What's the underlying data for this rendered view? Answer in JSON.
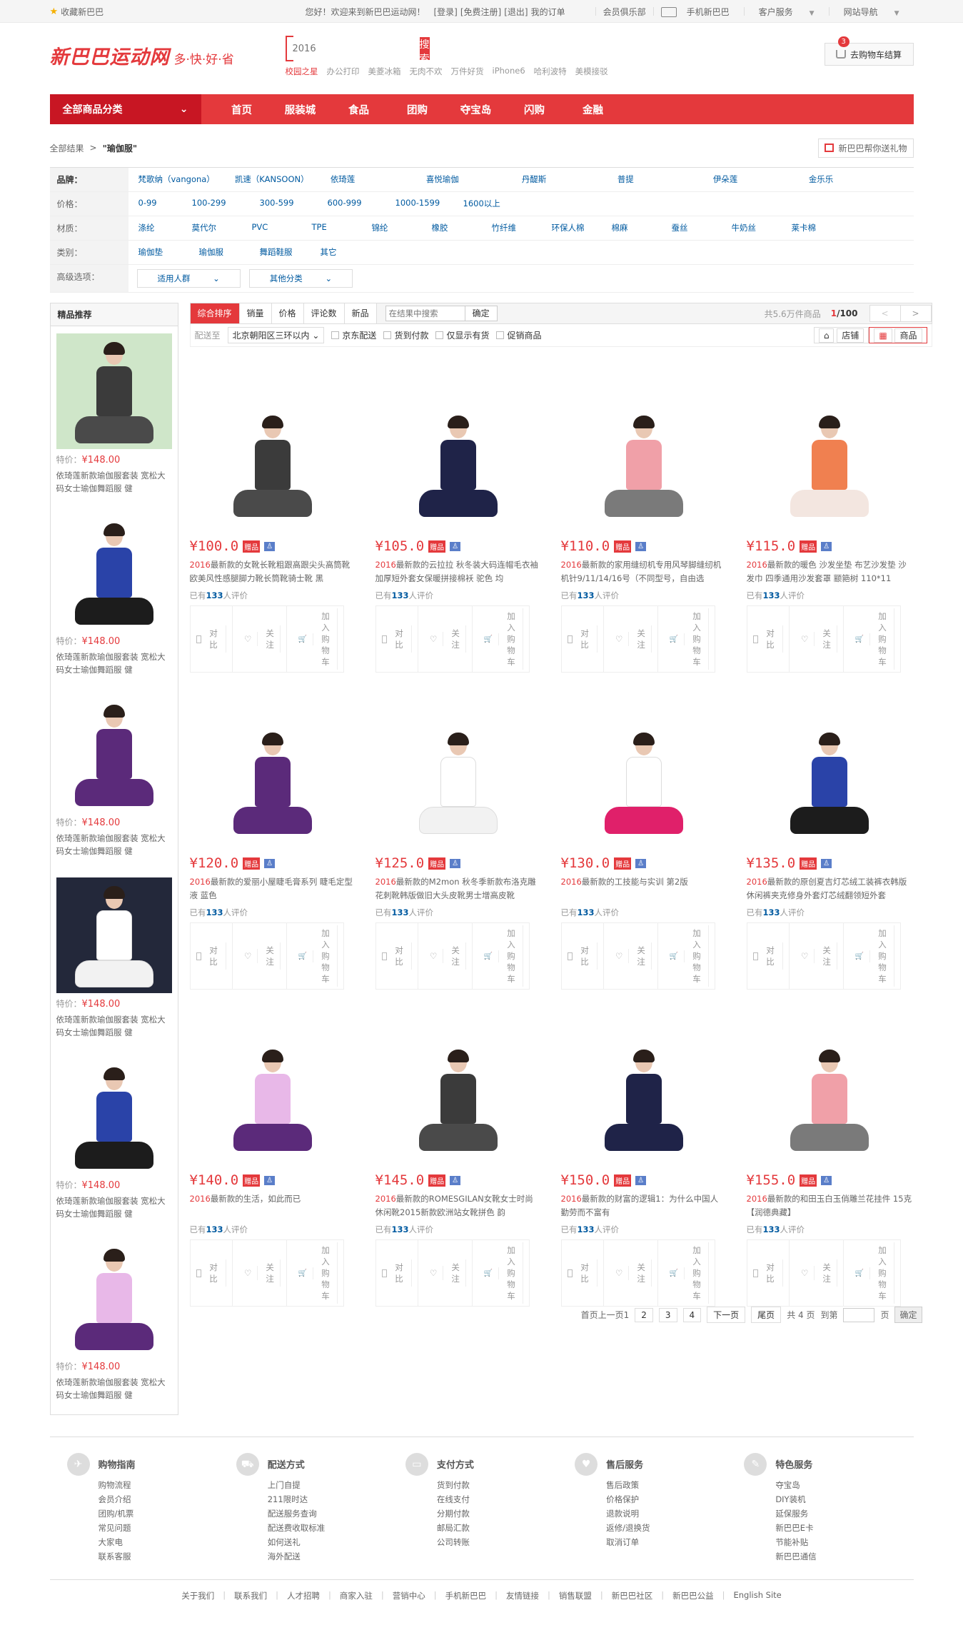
{
  "topbar": {
    "favorite": "收藏新巴巴",
    "welcome": "您好！欢迎来到新巴巴运动网！",
    "login": "[登录]",
    "register": "[免费注册]",
    "logout": "[退出]",
    "orders": "我的订单",
    "club": "会员俱乐部",
    "mobile": "手机新巴巴",
    "service": "客户服务",
    "sitenav": "网站导航"
  },
  "header": {
    "logo_name": "新巴巴运动网",
    "logo_slogan": "多·快·好·省",
    "search_placeholder": "2016",
    "search_button": "搜索",
    "hotwords": [
      "校园之星",
      "办公打印",
      "美菱冰箱",
      "无肉不欢",
      "万件好货",
      "iPhone6",
      "哈利波特",
      "美模接驳"
    ],
    "cart_label": "去购物车结算",
    "cart_count": "3"
  },
  "nav": {
    "all_label": "全部商品分类",
    "items": [
      "首页",
      "服装城",
      "食品",
      "团购",
      "夺宝岛",
      "闪购",
      "金融"
    ]
  },
  "breadcrumb": {
    "root": "全部结果",
    "arrow": ">",
    "current": "\"瑜伽服\"",
    "gift": "新巴巴帮你送礼物"
  },
  "filters": {
    "brand_label": "品牌：",
    "brands": [
      "梵歌纳（vangona）",
      "凯速（KANSOON）",
      "依琦莲",
      "喜悦瑜伽",
      "丹醍斯",
      "普提",
      "伊朵莲",
      "金乐乐"
    ],
    "price_label": "价格：",
    "prices": [
      "0-99",
      "100-299",
      "300-599",
      "600-999",
      "1000-1599",
      "1600以上"
    ],
    "material_label": "材质：",
    "materials": [
      "涤纶",
      "莫代尔",
      "PVC",
      "TPE",
      "锦纶",
      "橡胶",
      "竹纤维",
      "环保人棉",
      "棉麻",
      "蚕丝",
      "牛奶丝",
      "莱卡棉"
    ],
    "category_label": "类别：",
    "categories": [
      "瑜伽垫",
      "瑜伽服",
      "舞蹈鞋服",
      "其它"
    ],
    "advanced_label": "高级选项：",
    "advanced": [
      "适用人群",
      "其他分类"
    ]
  },
  "sidebar": {
    "title": "精品推荐",
    "price_prefix": "特价：",
    "items": [
      {
        "price": "¥148.00",
        "desc": "依琦莲新款瑜伽服套装 宽松大码女士瑜伽舞蹈服 健"
      },
      {
        "price": "¥148.00",
        "desc": "依琦莲新款瑜伽服套装 宽松大码女士瑜伽舞蹈服 健"
      },
      {
        "price": "¥148.00",
        "desc": "依琦莲新款瑜伽服套装 宽松大码女士瑜伽舞蹈服 健"
      },
      {
        "price": "¥148.00",
        "desc": "依琦莲新款瑜伽服套装 宽松大码女士瑜伽舞蹈服 健"
      },
      {
        "price": "¥148.00",
        "desc": "依琦莲新款瑜伽服套装 宽松大码女士瑜伽舞蹈服 健"
      },
      {
        "price": "¥148.00",
        "desc": "依琦莲新款瑜伽服套装 宽松大码女士瑜伽舞蹈服 健"
      }
    ]
  },
  "sortbar": {
    "options": [
      "综合排序",
      "销量",
      "价格",
      "评论数",
      "新品"
    ],
    "search_placeholder": "在结果中搜索",
    "confirm": "确定",
    "total_prefix": "共",
    "total": "5.6万",
    "total_suffix": "件商品",
    "page": "1",
    "pages": "/100",
    "prev": "<",
    "next": ">"
  },
  "shipbar": {
    "label": "配送至",
    "region": "北京朝阳区三环以内",
    "checks": [
      "京东配送",
      "货到付款",
      "仅显示有货",
      "促销商品"
    ],
    "view_shop": "店铺",
    "view_goods": "商品"
  },
  "products": [
    {
      "price": "¥100.0",
      "prefix": "2016",
      "title": "最新款的女靴长靴粗跟高跟尖头高筒靴欧美风性感腿脚力靴长筒靴骑士靴 黑",
      "reviews": "133"
    },
    {
      "price": "¥105.0",
      "prefix": "2016",
      "title": "最新款的云拉拉 秋冬装大码连帽毛衣袖加厚短外套女保暖拼接棉袄 驼色 均",
      "reviews": "133"
    },
    {
      "price": "¥110.0",
      "prefix": "2016",
      "title": "最新款的家用缝纫机专用风琴脚缝纫机机针9/11/14/16号（不同型号，自由选",
      "reviews": "133"
    },
    {
      "price": "¥115.0",
      "prefix": "2016",
      "title": "最新款的暖色 沙发坐垫 布艺沙发垫 沙发巾 四季通用沙发套罩 颛筢树 110*11",
      "reviews": "133"
    },
    {
      "price": "¥120.0",
      "prefix": "2016",
      "title": "最新款的爱丽小屋睫毛膏系列 睫毛定型液 蓝色",
      "reviews": "133"
    },
    {
      "price": "¥125.0",
      "prefix": "2016",
      "title": "最新款的M2mon 秋冬季新款布洛克雕花刺靴韩版做旧大头皮靴男士增高皮靴",
      "reviews": "133"
    },
    {
      "price": "¥130.0",
      "prefix": "2016",
      "title": "最新款的工技能与实训 第2版",
      "reviews": "133"
    },
    {
      "price": "¥135.0",
      "prefix": "2016",
      "title": "最新款的原创夏吉灯芯绒工装裤衣韩版休闲裤夹克修身外套灯芯绒翻领短外套",
      "reviews": "133"
    },
    {
      "price": "¥140.0",
      "prefix": "2016",
      "title": "最新款的生活，如此而已",
      "reviews": "133"
    },
    {
      "price": "¥145.0",
      "prefix": "2016",
      "title": "最新款的ROMESGILAN女靴女士时尚休闲靴2015新款欧洲站女靴拼色 韵",
      "reviews": "133"
    },
    {
      "price": "¥150.0",
      "prefix": "2016",
      "title": "最新款的财富的逻辑1：为什么中国人勤劳而不富有",
      "reviews": "133"
    },
    {
      "price": "¥155.0",
      "prefix": "2016",
      "title": "最新款的和田玉白玉俏雕兰花挂件 15克【润德典藏】",
      "reviews": "133"
    }
  ],
  "product_labels": {
    "tag_gift": "赠品",
    "review_prefix": "已有",
    "review_suffix": "人评价",
    "compare": "对比",
    "follow": "关注",
    "add_cart": "加入购物车"
  },
  "pagination": {
    "first": "首页",
    "prev": "上一页",
    "current": "1",
    "pages": [
      "2",
      "3",
      "4"
    ],
    "next": "下一页",
    "last": "尾页",
    "total": "共 4 页",
    "goto": "到第",
    "page_unit": "页",
    "confirm": "确定"
  },
  "footer": {
    "columns": [
      {
        "icon": "plane-icon",
        "title": "购物指南",
        "links": [
          "购物流程",
          "会员介绍",
          "团购/机票",
          "常见问题",
          "大家电",
          "联系客服"
        ]
      },
      {
        "icon": "truck-icon",
        "title": "配送方式",
        "links": [
          "上门自提",
          "211限时达",
          "配送服务查询",
          "配送费收取标准",
          "如何送礼",
          "海外配送"
        ]
      },
      {
        "icon": "wallet-icon",
        "title": "支付方式",
        "links": [
          "货到付款",
          "在线支付",
          "分期付款",
          "邮局汇款",
          "公司转账"
        ]
      },
      {
        "icon": "heart-icon",
        "title": "售后服务",
        "links": [
          "售后政策",
          "价格保护",
          "退款说明",
          "返修/退换货",
          "取消订单"
        ]
      },
      {
        "icon": "wrench-icon",
        "title": "特色服务",
        "links": [
          "夺宝岛",
          "DIY装机",
          "延保服务",
          "新巴巴E卡",
          "节能补贴",
          "新巴巴通信"
        ]
      }
    ],
    "links": [
      "关于我们",
      "联系我们",
      "人才招聘",
      "商家入驻",
      "营销中心",
      "手机新巴巴",
      "友情链接",
      "销售联盟",
      "新巴巴社区",
      "新巴巴公益",
      "English Site"
    ]
  },
  "colors": {
    "brand": "#e4393c",
    "nav_dark": "#c81623",
    "link": "#005aa0"
  }
}
